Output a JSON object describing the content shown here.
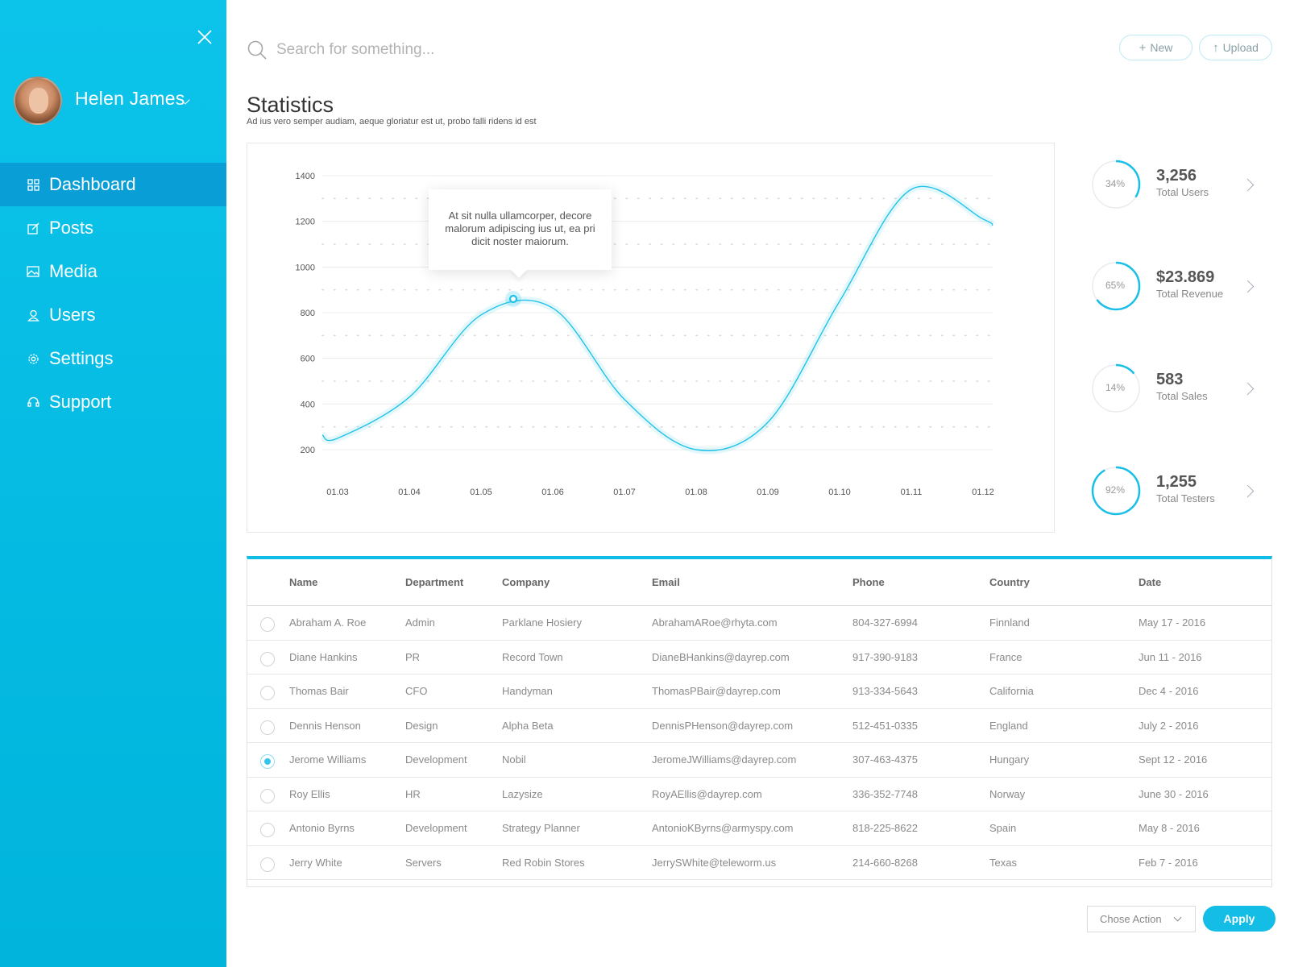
{
  "sidebar": {
    "user": {
      "name": "Helen James"
    },
    "items": [
      {
        "label": "Dashboard",
        "icon": "dashboard-icon",
        "active": true
      },
      {
        "label": "Posts",
        "icon": "edit-icon",
        "active": false
      },
      {
        "label": "Media",
        "icon": "image-icon",
        "active": false
      },
      {
        "label": "Users",
        "icon": "user-icon",
        "active": false
      },
      {
        "label": "Settings",
        "icon": "gear-icon",
        "active": false
      },
      {
        "label": "Support",
        "icon": "headset-icon",
        "active": false
      }
    ]
  },
  "header": {
    "search_placeholder": "Search for something...",
    "new_label": "New",
    "upload_label": "Upload"
  },
  "statistics": {
    "title": "Statistics",
    "subtitle": "Ad ius vero semper audiam, aeque gloriatur est ut, probo falli ridens id est",
    "tooltip": "At sit nulla ullamcorper, decore malorum adipiscing ius ut, ea pri dicit noster maiorum."
  },
  "chart_data": {
    "type": "line",
    "x": [
      "01.03",
      "01.04",
      "01.05",
      "01.06",
      "01.07",
      "01.08",
      "01.09",
      "01.10",
      "01.11",
      "01.12"
    ],
    "y_ticks": [
      200,
      400,
      600,
      800,
      1000,
      1200,
      1400
    ],
    "ylim": [
      200,
      1400
    ],
    "series": [
      {
        "values": [
          250,
          430,
          790,
          820,
          420,
          200,
          320,
          850,
          1340,
          1210
        ]
      }
    ],
    "highlight": {
      "x": "01.05",
      "y": 860
    },
    "grid": true,
    "color": "#21c2e8"
  },
  "kpis": [
    {
      "percent": "34%",
      "fraction": 0.34,
      "value": "3,256",
      "label": "Total Users"
    },
    {
      "percent": "65%",
      "fraction": 0.65,
      "value": "$23.869",
      "label": "Total Revenue"
    },
    {
      "percent": "14%",
      "fraction": 0.14,
      "value": "583",
      "label": "Total Sales"
    },
    {
      "percent": "92%",
      "fraction": 0.92,
      "value": "1,255",
      "label": "Total Testers"
    }
  ],
  "table": {
    "columns": [
      "Name",
      "Department",
      "Company",
      "Email",
      "Phone",
      "Country",
      "Date"
    ],
    "rows": [
      {
        "selected": false,
        "cells": [
          "Abraham A. Roe",
          "Admin",
          "Parklane Hosiery",
          "AbrahamARoe@rhyta.com",
          "804-327-6994",
          "Finnland",
          "May 17 - 2016"
        ]
      },
      {
        "selected": false,
        "cells": [
          "Diane Hankins",
          "PR",
          "Record Town",
          "DianeBHankins@dayrep.com",
          "917-390-9183",
          "France",
          "Jun 11 - 2016"
        ]
      },
      {
        "selected": false,
        "cells": [
          "Thomas Bair",
          "CFO",
          "Handyman",
          "ThomasPBair@dayrep.com",
          "913-334-5643",
          "California",
          "Dec 4 - 2016"
        ]
      },
      {
        "selected": false,
        "cells": [
          "Dennis Henson",
          "Design",
          "Alpha Beta",
          "DennisPHenson@dayrep.com",
          "512-451-0335",
          "England",
          "July 2 - 2016"
        ]
      },
      {
        "selected": true,
        "cells": [
          "Jerome Williams",
          "Development",
          "Nobil",
          "JeromeJWilliams@dayrep.com",
          "307-463-4375",
          "Hungary",
          "Sept 12 - 2016"
        ]
      },
      {
        "selected": false,
        "cells": [
          "Roy Ellis",
          "HR",
          "Lazysize",
          "RoyAEllis@dayrep.com",
          "336-352-7748",
          "Norway",
          "June 30 - 2016"
        ]
      },
      {
        "selected": false,
        "cells": [
          "Antonio Byrns",
          "Development",
          "Strategy Planner",
          "AntonioKByrns@armyspy.com",
          "818-225-8622",
          "Spain",
          "May 8 - 2016"
        ]
      },
      {
        "selected": false,
        "cells": [
          "Jerry White",
          "Servers",
          "Red Robin Stores",
          "JerrySWhite@teleworm.us",
          "214-660-8268",
          "Texas",
          "Feb 7 - 2016"
        ]
      }
    ]
  },
  "actions": {
    "select_label": "Chose Action",
    "apply_label": "Apply"
  }
}
